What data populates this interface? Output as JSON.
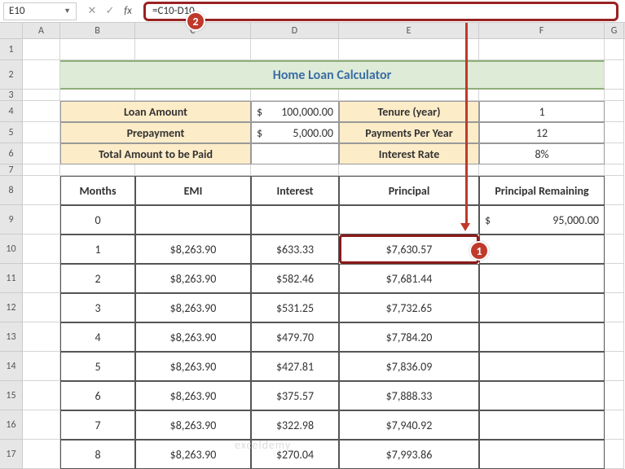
{
  "name_box": "E10",
  "formula": "=C10-D10",
  "columns": [
    "A",
    "B",
    "C",
    "D",
    "E",
    "F",
    "G"
  ],
  "rows": [
    "1",
    "2",
    "3",
    "4",
    "5",
    "6",
    "7",
    "8",
    "9",
    "10",
    "11",
    "12",
    "13",
    "14",
    "15",
    "16",
    "17"
  ],
  "title": "Home Loan Calculator",
  "params": {
    "loan_amount_label": "Loan Amount",
    "loan_amount_curr": "$",
    "loan_amount_val": "100,000.00",
    "tenure_label": "Tenure (year)",
    "tenure_val": "1",
    "prepay_label": "Prepayment",
    "prepay_curr": "$",
    "prepay_val": "5,000.00",
    "ppy_label": "Payments Per Year",
    "ppy_val": "12",
    "total_label": "Total Amount to be Paid",
    "rate_label": "Interest Rate",
    "rate_val": "8%"
  },
  "table": {
    "headers": [
      "Months",
      "EMI",
      "Interest",
      "Principal",
      "Principal Remaining"
    ],
    "row0": {
      "month": "0",
      "remaining_curr": "$",
      "remaining_val": "95,000.00"
    },
    "rows": [
      {
        "month": "1",
        "emi": "$8,263.90",
        "interest": "$633.33",
        "principal": "$7,630.57"
      },
      {
        "month": "2",
        "emi": "$8,263.90",
        "interest": "$582.46",
        "principal": "$7,681.44"
      },
      {
        "month": "3",
        "emi": "$8,263.90",
        "interest": "$531.25",
        "principal": "$7,732.65"
      },
      {
        "month": "4",
        "emi": "$8,263.90",
        "interest": "$479.70",
        "principal": "$7,784.20"
      },
      {
        "month": "5",
        "emi": "$8,263.90",
        "interest": "$427.81",
        "principal": "$7,836.09"
      },
      {
        "month": "6",
        "emi": "$8,263.90",
        "interest": "$375.57",
        "principal": "$7,888.33"
      },
      {
        "month": "7",
        "emi": "$8,263.90",
        "interest": "$322.98",
        "principal": "$7,940.92"
      },
      {
        "month": "8",
        "emi": "$8,263.90",
        "interest": "$270.04",
        "principal": "$7,993.86"
      }
    ]
  },
  "badges": {
    "b1": "1",
    "b2": "2"
  },
  "watermark": "exceldemy"
}
